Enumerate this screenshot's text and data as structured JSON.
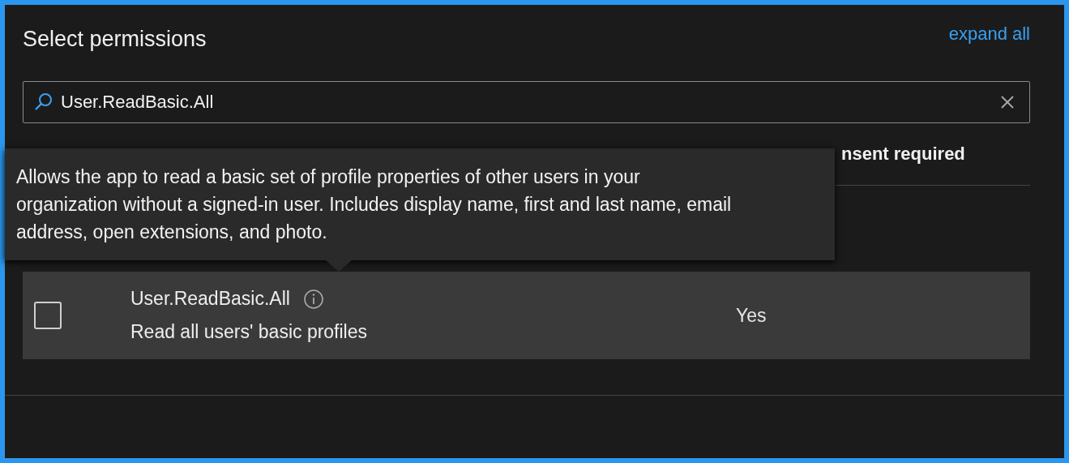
{
  "panel": {
    "title": "Select permissions",
    "expand_link": "expand all"
  },
  "search": {
    "value": "User.ReadBasic.All"
  },
  "table": {
    "columns": [
      {
        "label": "nsent required"
      }
    ],
    "rows": [
      {
        "checked": false,
        "name": "User.ReadBasic.All",
        "description": "Read all users' basic profiles",
        "admin_consent": "Yes"
      }
    ]
  },
  "tooltip": {
    "text": "Allows the app to read a basic set of profile properties of other users in your organization without a signed-in user. Includes display name, first and last name, email address, open extensions, and photo."
  }
}
